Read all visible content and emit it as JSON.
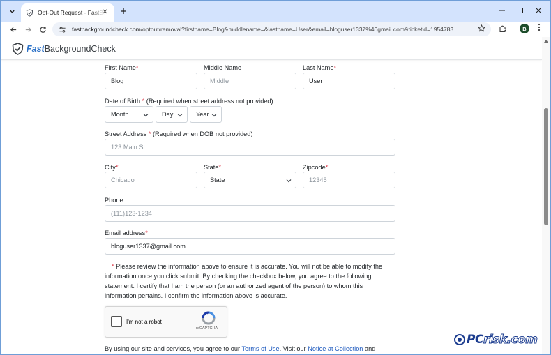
{
  "browser": {
    "tab_title": "Opt-Out Request - FastBackgroundCheck",
    "url_domain": "fastbackgroundcheck.com",
    "url_path": "/optout/removal?firstname=Blog&middlename=&lastname=User&email=bloguser1337%40gmail.com&ticketid=1954783",
    "profile_initial": "B"
  },
  "site": {
    "logo_bold": "Fast",
    "logo_rest": "BackgroundCheck"
  },
  "form": {
    "first_name_label": "First Name",
    "first_name_value": "Blog",
    "middle_name_label": "Middle Name",
    "middle_name_placeholder": "Middle",
    "last_name_label": "Last Name",
    "last_name_value": "User",
    "dob_label": "Date of Birth",
    "dob_note": " (Required when street address not provided)",
    "dob_month": "Month",
    "dob_day": "Day",
    "dob_year": "Year",
    "street_label": "Street Address",
    "street_note": " (Required when DOB not provided)",
    "street_placeholder": "123 Main St",
    "city_label": "City",
    "city_placeholder": "Chicago",
    "state_label": "State",
    "state_value": "State",
    "zip_label": "Zipcode",
    "zip_placeholder": "12345",
    "phone_label": "Phone",
    "phone_placeholder": "(111)123-1234",
    "email_label": "Email address",
    "email_value": "bloguser1337@gmail.com",
    "required_mark": "*",
    "consent_text": "Please review the information above to ensure it is accurate. You will not be able to modify the information once you click submit. By checking the checkbox below, you agree to the following statement: I certify that I am the person (or an authorized agent of the person) to whom this information pertains. I confirm the information above is accurate."
  },
  "captcha": {
    "label": "I'm not a robot",
    "brand": "reCAPTCHA"
  },
  "footer": {
    "prefix": "By using our site and services, you agree to our ",
    "terms_link": "Terms of Use",
    "middle": ". Visit our ",
    "notice_link": "Notice at Collection",
    "suffix": " and"
  },
  "watermark": {
    "pc": "PC",
    "risk": "risk.com"
  },
  "colors": {
    "tab_strip": "#d3e3fd",
    "brand_blue": "#2e73c8",
    "required_red": "#dc3545",
    "link": "#1f5bbf"
  }
}
